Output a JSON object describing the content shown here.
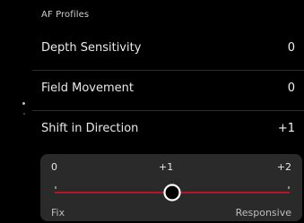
{
  "header": {
    "title": "AF Profiles"
  },
  "menu": {
    "items": [
      {
        "label": "Depth Sensitivity",
        "value": "0"
      },
      {
        "label": "Field Movement",
        "value": "0"
      },
      {
        "label": "Shift in Direction",
        "value": "+1"
      }
    ]
  },
  "slider": {
    "tick_labels": [
      "0",
      "+1",
      "+2"
    ],
    "left_label": "Fix",
    "right_label": "Responsive",
    "value_fraction": 0.5,
    "accent_color": "#b3152a",
    "knob_color": "#ffffff"
  },
  "pager": {
    "page_count": 2,
    "active_index": 0
  }
}
